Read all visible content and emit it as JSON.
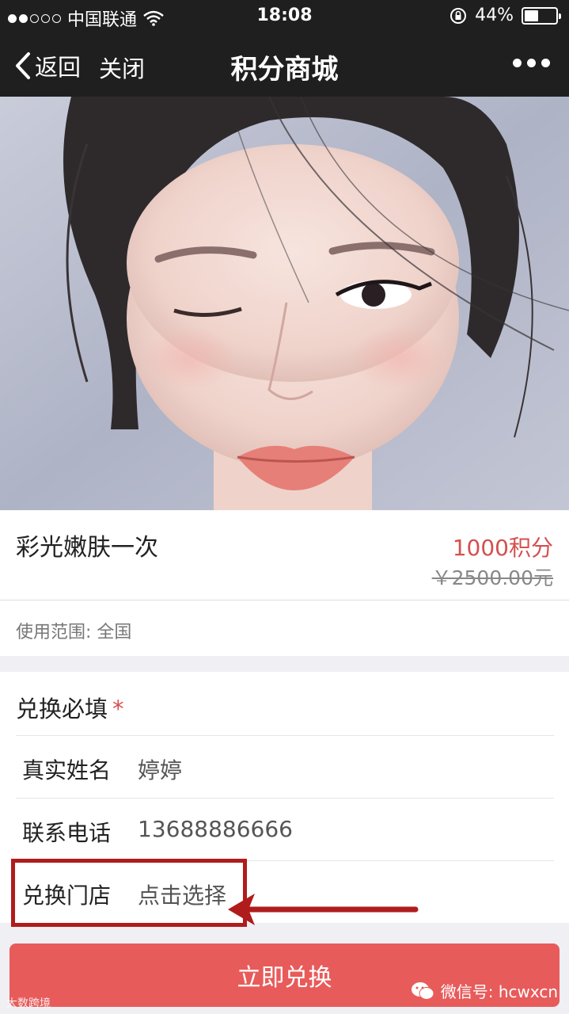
{
  "status_bar": {
    "carrier": "中国联通",
    "time": "18:08",
    "battery": "44%",
    "battery_level": 0.44,
    "signal_strength": 2,
    "icons": [
      "signal-dots-icon",
      "wifi-icon",
      "orientation-lock-icon",
      "battery-icon"
    ]
  },
  "nav": {
    "back_label": "返回",
    "close_label": "关闭",
    "title": "积分商城",
    "more_icon": "more-dots-icon"
  },
  "product": {
    "name": "彩光嫩肤一次",
    "points": "1000积分",
    "original_price": "￥2500.00元",
    "scope": "使用范围: 全国"
  },
  "form": {
    "title": "兑换必填",
    "required_mark": "*",
    "fields": [
      {
        "label": "真实姓名",
        "value": "婷婷"
      },
      {
        "label": "联系电话",
        "value": "13688886666"
      },
      {
        "label": "兑换门店",
        "value": "点击选择"
      }
    ]
  },
  "actions": {
    "exchange_label": "立即兑换"
  },
  "watermarks": {
    "left": "大数跨境",
    "right": "微信号: hcwxcn"
  },
  "colors": {
    "accent": "#e85b5b",
    "points": "#d4504f",
    "highlight": "#b01c1c",
    "nav_bg": "#1f1f1f"
  }
}
